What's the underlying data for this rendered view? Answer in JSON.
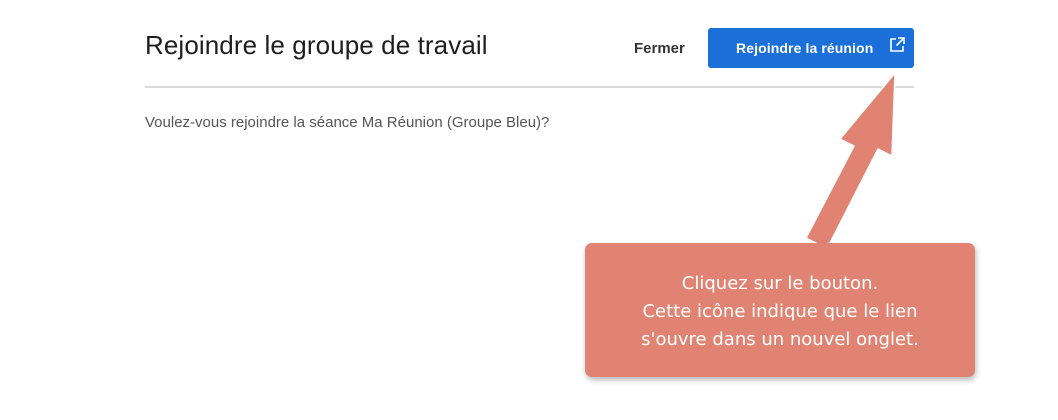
{
  "dialog": {
    "title": "Rejoindre le groupe de travail",
    "close_label": "Fermer",
    "join_label": "Rejoindre la réunion",
    "join_icon": "external-link-icon",
    "message": "Voulez-vous rejoindre la séance Ma Réunion (Groupe Bleu)?"
  },
  "callout": {
    "lines": [
      "Cliquez sur le bouton.",
      "Cette icône indique que le lien",
      "s'ouvre dans un nouvel onglet."
    ]
  },
  "colors": {
    "accent": "#1b6fd8",
    "callout": "#e08372"
  }
}
